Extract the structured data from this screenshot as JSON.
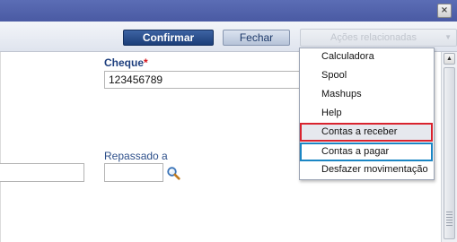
{
  "window": {
    "close_glyph": "×"
  },
  "toolbar": {
    "confirm_label": "Confirmar",
    "close_label": "Fechar",
    "related_actions_label": "Ações relacionadas",
    "related_actions_caret": "▼"
  },
  "form": {
    "cheque_label": "Cheque",
    "cheque_required_mark": "*",
    "cheque_value": "123456789",
    "repassado_label": "Repassado a",
    "repassado_value": "",
    "left_field_value": ""
  },
  "menu": {
    "items": [
      {
        "label": "Calculadora"
      },
      {
        "label": "Spool"
      },
      {
        "label": "Mashups"
      },
      {
        "label": "Help"
      },
      {
        "label": "Contas a receber",
        "highlight": "#d9232e"
      },
      {
        "label": "Contas a pagar",
        "highlight": "#1b86c4"
      },
      {
        "label": "Desfazer movimentação"
      }
    ]
  },
  "scrollbar": {
    "up_glyph": "▲"
  },
  "colors": {
    "titlebar": "#4f61ab",
    "primary_button": "#1c3e78",
    "label_blue": "#1e3f7e",
    "required": "#d4141a"
  }
}
